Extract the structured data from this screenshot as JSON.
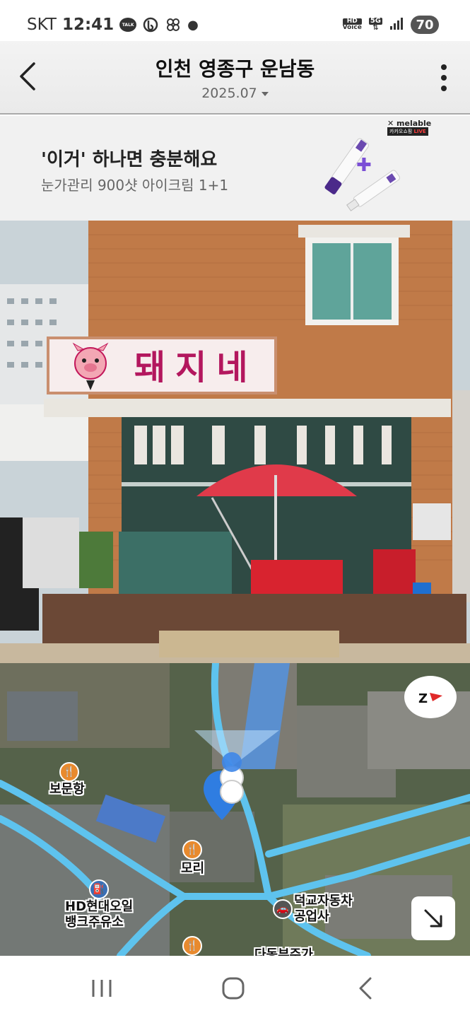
{
  "status_bar": {
    "carrier": "SKT",
    "time": "12:41",
    "talk_icon_text": "TALK",
    "hd_label": "HD",
    "voice_label": "Voice",
    "network": "5G",
    "battery": "70"
  },
  "header": {
    "title": "인천 영종구 운남동",
    "date": "2025.07"
  },
  "ad": {
    "title": "'이거' 하나면 충분해요",
    "subtitle": "눈가관리 900샷 아이크림 1+1",
    "brand": "melable",
    "live_prefix": "카카오쇼핑",
    "live_label": "LIVE"
  },
  "street": {
    "sign_text": "돼지네"
  },
  "map": {
    "labels": {
      "bomunhang": "보문항",
      "mori": "모리",
      "gas_line1": "HD현대오일",
      "gas_line2": "뱅크주유소",
      "repair_line1": "덕교자동차",
      "repair_line2": "공업사",
      "partial": "다동부주가"
    }
  },
  "colors": {
    "road": "#5ec3ee",
    "pin": "#2f7de1",
    "poi_food": "#e88a2e",
    "poi_gas": "#3a6fb5"
  }
}
